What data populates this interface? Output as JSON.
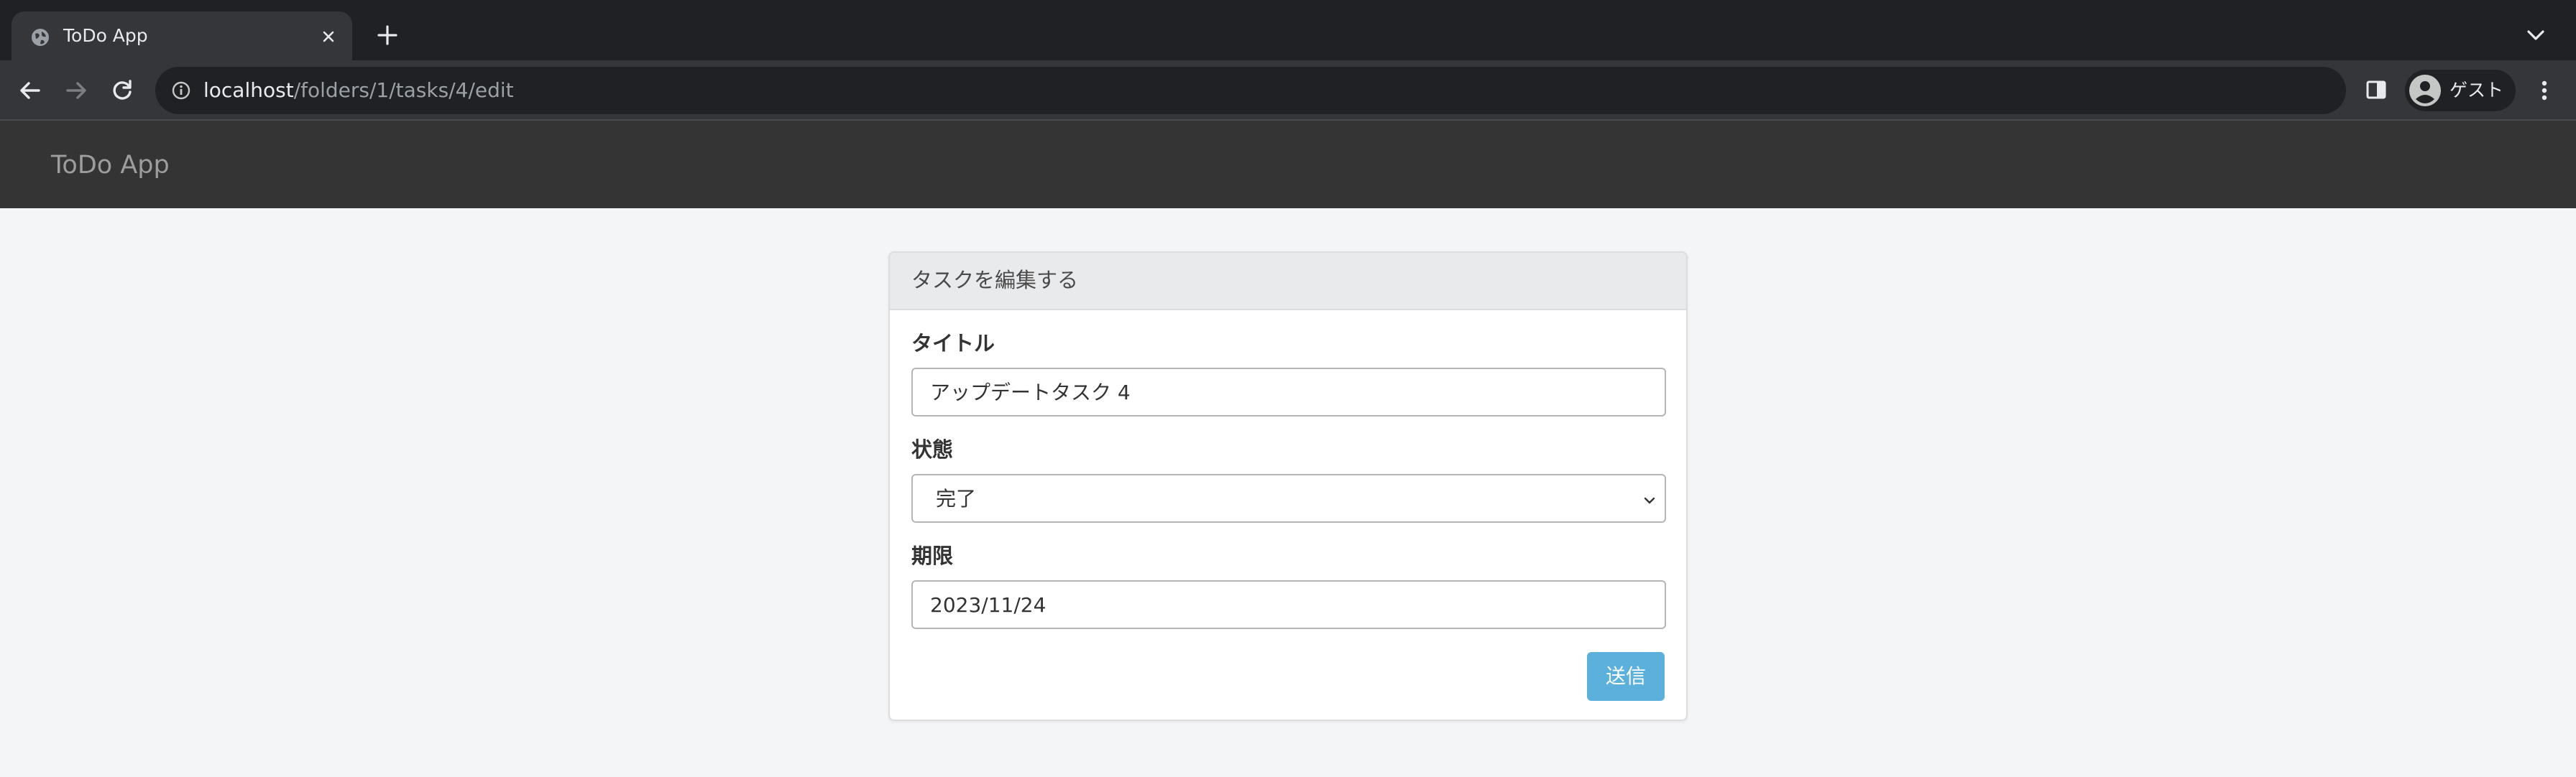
{
  "browser": {
    "tab": {
      "title": "ToDo App"
    },
    "address_bar": {
      "host": "localhost",
      "path": "/folders/1/tasks/4/edit"
    },
    "profile": {
      "name": "ゲスト"
    }
  },
  "app": {
    "brand": "ToDo App"
  },
  "edit_task_form": {
    "heading": "タスクを編集する",
    "title_field": {
      "label": "タイトル",
      "value": "アップデートタスク 4"
    },
    "status_field": {
      "label": "状態",
      "selected": "完了"
    },
    "due_date_field": {
      "label": "期限",
      "value": "2023/11/24"
    },
    "submit_label": "送信"
  },
  "colors": {
    "navbar": "#343434",
    "submit_button": "#5bb0dc",
    "page_background": "#f4f5f7"
  }
}
